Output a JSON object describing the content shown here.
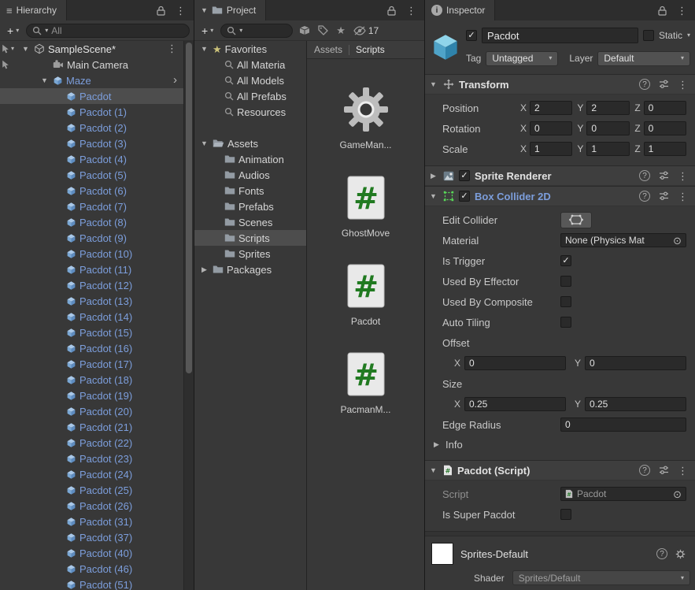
{
  "icons": {
    "kebab": "⋮",
    "caret": "▾",
    "fold_open": "▼",
    "fold_closed": "▶",
    "star": "★",
    "picker": "⊙",
    "check": "✓",
    "plus": "+",
    "chevron_right": "›",
    "menu": "≡",
    "help": "?",
    "info": "i"
  },
  "hierarchy": {
    "tab": "Hierarchy",
    "search_value": "All",
    "scene": "SampleScene*",
    "main_camera": "Main Camera",
    "maze": "Maze",
    "pacdots": [
      {
        "label": "Pacdot",
        "selected": true
      },
      {
        "label": "Pacdot (1)"
      },
      {
        "label": "Pacdot (2)"
      },
      {
        "label": "Pacdot (3)"
      },
      {
        "label": "Pacdot (4)"
      },
      {
        "label": "Pacdot (5)"
      },
      {
        "label": "Pacdot (6)"
      },
      {
        "label": "Pacdot (7)"
      },
      {
        "label": "Pacdot (8)"
      },
      {
        "label": "Pacdot (9)"
      },
      {
        "label": "Pacdot (10)"
      },
      {
        "label": "Pacdot (11)"
      },
      {
        "label": "Pacdot (12)"
      },
      {
        "label": "Pacdot (13)"
      },
      {
        "label": "Pacdot (14)"
      },
      {
        "label": "Pacdot (15)"
      },
      {
        "label": "Pacdot (16)"
      },
      {
        "label": "Pacdot (17)"
      },
      {
        "label": "Pacdot (18)"
      },
      {
        "label": "Pacdot (19)"
      },
      {
        "label": "Pacdot (20)"
      },
      {
        "label": "Pacdot (21)"
      },
      {
        "label": "Pacdot (22)"
      },
      {
        "label": "Pacdot (23)"
      },
      {
        "label": "Pacdot (24)"
      },
      {
        "label": "Pacdot (25)"
      },
      {
        "label": "Pacdot (26)"
      },
      {
        "label": "Pacdot (31)"
      },
      {
        "label": "Pacdot (37)"
      },
      {
        "label": "Pacdot (40)"
      },
      {
        "label": "Pacdot (46)"
      },
      {
        "label": "Pacdot (51)"
      }
    ]
  },
  "project": {
    "tab": "Project",
    "hidden_count": "17",
    "breadcrumb_root": "Assets",
    "breadcrumb_current": "Scripts",
    "favorites_label": "Favorites",
    "favorites": [
      "All Materia",
      "All Models",
      "All Prefabs",
      "Resources"
    ],
    "assets_label": "Assets",
    "folders": [
      {
        "label": "Animation"
      },
      {
        "label": "Audios"
      },
      {
        "label": "Fonts"
      },
      {
        "label": "Prefabs"
      },
      {
        "label": "Scenes"
      },
      {
        "label": "Scripts",
        "selected": true
      },
      {
        "label": "Sprites"
      }
    ],
    "packages_label": "Packages",
    "assets": [
      {
        "name": "GameMan...",
        "gear": true
      },
      {
        "name": "GhostMove"
      },
      {
        "name": "Pacdot"
      },
      {
        "name": "PacmanM..."
      }
    ]
  },
  "inspector": {
    "tab": "Inspector",
    "name": "Pacdot",
    "static_label": "Static",
    "tag_label": "Tag",
    "tag_value": "Untagged",
    "layer_label": "Layer",
    "layer_value": "Default",
    "axes": {
      "x": "X",
      "y": "Y",
      "z": "Z"
    },
    "transform": {
      "title": "Transform",
      "rows": [
        {
          "label": "Position",
          "x": "2",
          "y": "2",
          "z": "0"
        },
        {
          "label": "Rotation",
          "x": "0",
          "y": "0",
          "z": "0"
        },
        {
          "label": "Scale",
          "x": "1",
          "y": "1",
          "z": "1"
        }
      ]
    },
    "sprite_renderer_title": "Sprite Renderer",
    "box_collider": {
      "title": "Box Collider 2D",
      "edit_collider": "Edit Collider",
      "material_label": "Material",
      "material_value": "None (Physics Mat",
      "toggles": [
        {
          "label": "Is Trigger",
          "checked": true
        },
        {
          "label": "Used By Effector"
        },
        {
          "label": "Used By Composite"
        },
        {
          "label": "Auto Tiling"
        }
      ],
      "offset_label": "Offset",
      "offset_x": "0",
      "offset_y": "0",
      "size_label": "Size",
      "size_x": "0.25",
      "size_y": "0.25",
      "edge_radius_label": "Edge Radius",
      "edge_radius": "0",
      "info_label": "Info"
    },
    "script": {
      "title": "Pacdot (Script)",
      "script_label": "Script",
      "script_value": "Pacdot",
      "super_label": "Is Super Pacdot"
    },
    "material": {
      "title": "Sprites-Default",
      "shader_label": "Shader",
      "shader_value": "Sprites/Default"
    }
  }
}
